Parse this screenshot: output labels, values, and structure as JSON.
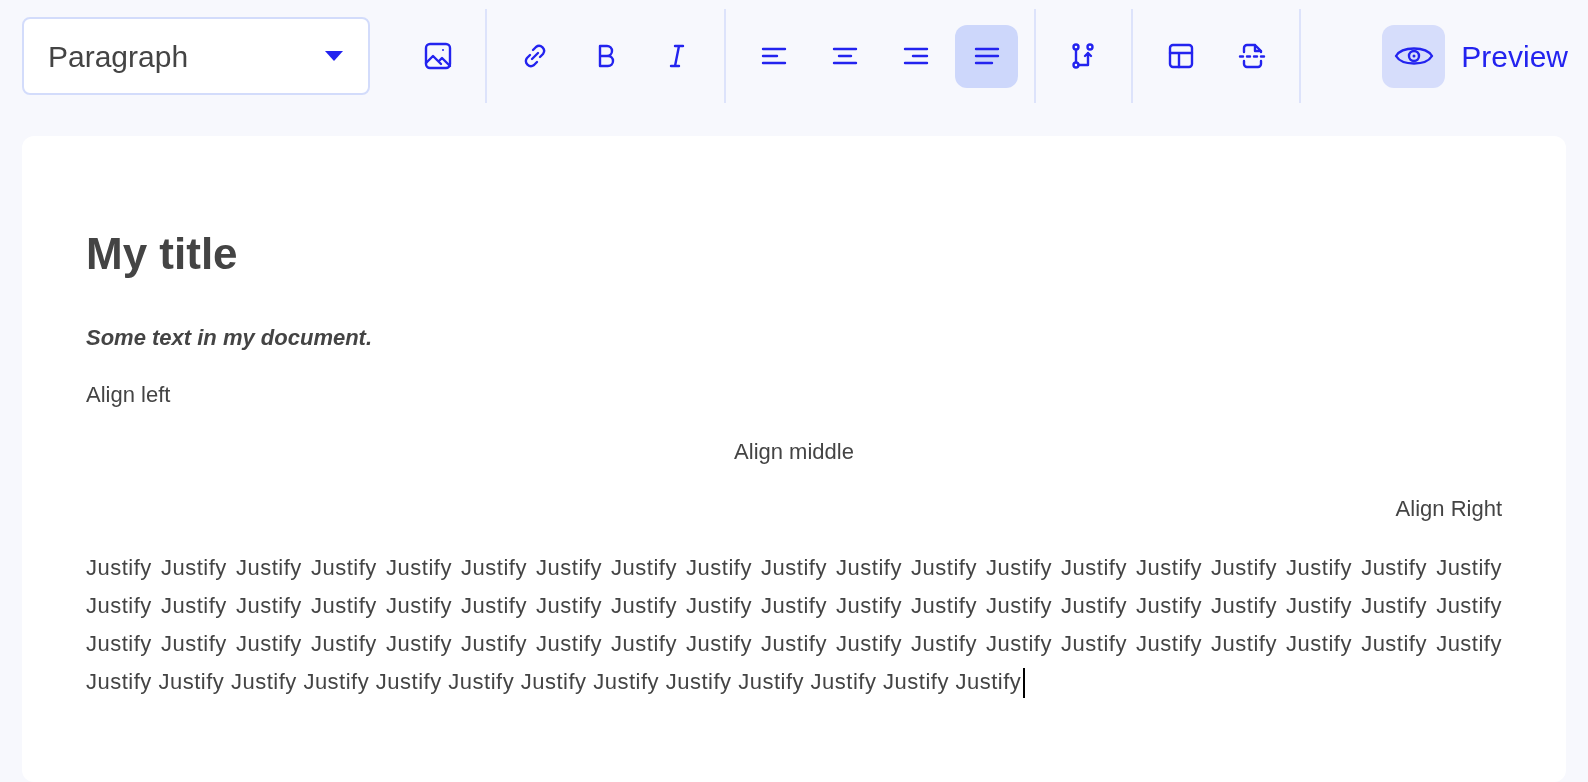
{
  "toolbar": {
    "block_format": {
      "value": "Paragraph"
    },
    "groups": [
      [
        {
          "kind": "image",
          "selected": false
        }
      ],
      [
        {
          "kind": "link",
          "selected": false
        },
        {
          "kind": "bold",
          "selected": false
        },
        {
          "kind": "italic",
          "selected": false
        }
      ],
      [
        {
          "kind": "align-left",
          "selected": false
        },
        {
          "kind": "align-center",
          "selected": false
        },
        {
          "kind": "align-right",
          "selected": false
        },
        {
          "kind": "align-justify",
          "selected": true
        }
      ],
      [
        {
          "kind": "branch",
          "selected": false
        }
      ],
      [
        {
          "kind": "table",
          "selected": false
        },
        {
          "kind": "page-break",
          "selected": false
        }
      ]
    ],
    "preview": {
      "label": "Preview",
      "selected": true
    }
  },
  "document": {
    "title": "My title",
    "blocks": [
      {
        "kind": "emphasis",
        "text": "Some text in my document."
      },
      {
        "kind": "left",
        "text": "Align left"
      },
      {
        "kind": "center",
        "text": "Align middle"
      },
      {
        "kind": "right",
        "text": "Align Right"
      },
      {
        "kind": "justify",
        "text": "Justify Justify Justify Justify Justify Justify Justify Justify Justify Justify Justify Justify Justify Justify Justify Justify Justify Justify Justify Justify Justify Justify Justify Justify Justify Justify Justify Justify Justify Justify Justify Justify Justify Justify Justify Justify Justify Justify Justify Justify Justify Justify Justify Justify Justify Justify Justify Justify Justify Justify Justify Justify Justify Justify Justify Justify Justify Justify Justify Justify Justify Justify Justify Justify Justify Justify Justify Justify Justify Justify",
        "cursor": true
      }
    ]
  }
}
